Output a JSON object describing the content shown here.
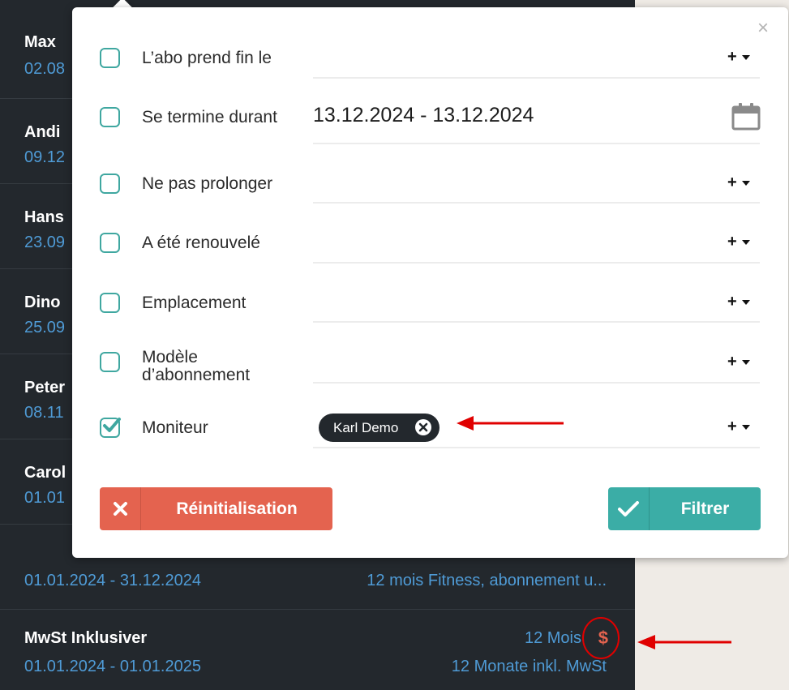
{
  "list": {
    "rows": [
      {
        "name": "Max",
        "dates": "02.08"
      },
      {
        "name": "Andi",
        "dates": "09.12"
      },
      {
        "name": "Hans",
        "dates": "23.09"
      },
      {
        "name": "Dino",
        "dates": "25.09"
      },
      {
        "name": "Peter",
        "dates": "08.11"
      },
      {
        "name": "Carol",
        "dates": "01.01"
      },
      {
        "name": "",
        "dates": "01.01.2024 - 31.12.2024",
        "contract": "12 mois Fitness, abonnement u..."
      },
      {
        "name": "MwSt Inklusiver",
        "dates": "01.01.2024 - 01.01.2025",
        "duration": "12 Mois",
        "contract": "12 Monate inkl. MwSt",
        "payment_icon": "$"
      }
    ]
  },
  "popup": {
    "close_label": "×",
    "filters": [
      {
        "label": "L’abo prend fin le",
        "checked": false
      },
      {
        "label": "Se termine durant",
        "checked": false,
        "value": "13.12.2024 - 13.12.2024"
      },
      {
        "label": "Ne pas prolonger",
        "checked": false
      },
      {
        "label": "A été renouvelé",
        "checked": false
      },
      {
        "label": "Emplacement",
        "checked": false
      },
      {
        "label_line1": "Modèle",
        "label_line2": "d’abonnement",
        "checked": false
      },
      {
        "label": "Moniteur",
        "checked": true,
        "chip": "Karl Demo"
      }
    ],
    "add_control": "+",
    "reset_label": "Réinitialisation",
    "filter_label": "Filtrer"
  },
  "colors": {
    "list_bg": "#23282d",
    "link_blue": "#4f9bd6",
    "teal": "#3bada6",
    "reset_red": "#e4634f",
    "annotation_red": "#e00000"
  },
  "icons": {
    "checkbox_checked": "check-icon",
    "calendar": "calendar-icon",
    "chip_remove": "circle-x-icon",
    "reset": "x-icon",
    "filter": "check-icon",
    "payment": "dollar-icon"
  }
}
